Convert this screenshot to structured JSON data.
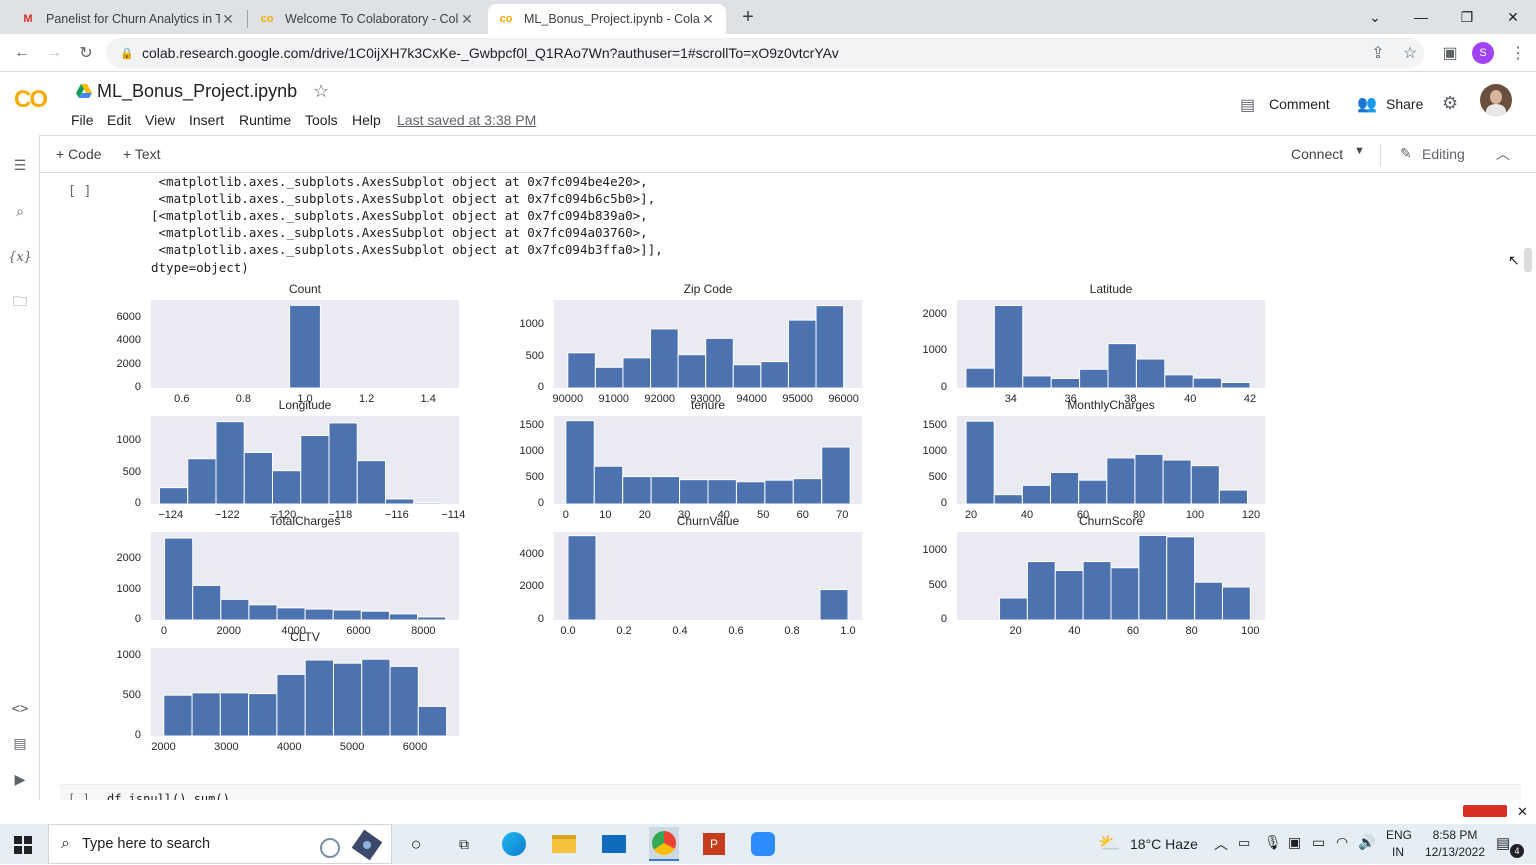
{
  "browser": {
    "tabs": [
      {
        "title": "Panelist for Churn Analytics in Te",
        "favicon": "M"
      },
      {
        "title": "Welcome To Colaboratory - Colab",
        "favicon": "co"
      },
      {
        "title": "ML_Bonus_Project.ipynb - Colab",
        "favicon": "co",
        "active": true
      }
    ],
    "new_tab": "+",
    "url": "colab.research.google.com/drive/1C0ijXH7k3CxKe-_Gwbpcf0l_Q1RAo7Wn?authuser=1#scrollTo=xO9z0vtcrYAv",
    "profile_initial": "S"
  },
  "colab": {
    "logo": "CO",
    "filename": "ML_Bonus_Project.ipynb",
    "menu": [
      "File",
      "Edit",
      "View",
      "Insert",
      "Runtime",
      "Tools",
      "Help"
    ],
    "last_saved": "Last saved at 3:38 PM",
    "comment": "Comment",
    "share": "Share",
    "toolbar": {
      "code": "+ Code",
      "text": "+ Text",
      "connect": "Connect",
      "editing": "Editing"
    },
    "cell_prompt": "[ ]",
    "next_cell_prompt": "[ ]",
    "next_cell_code": "df.isnull().sum()"
  },
  "output_text": [
    " <matplotlib.axes._subplots.AxesSubplot object at 0x7fc094be4e20>,",
    " <matplotlib.axes._subplots.AxesSubplot object at 0x7fc094b6c5b0>],",
    "[<matplotlib.axes._subplots.AxesSubplot object at 0x7fc094b839a0>,",
    " <matplotlib.axes._subplots.AxesSubplot object at 0x7fc094a03760>,",
    " <matplotlib.axes._subplots.AxesSubplot object at 0x7fc094b3ffa0>]],",
    "dtype=object)"
  ],
  "chart_data": [
    {
      "type": "bar",
      "title": "Count",
      "xlim": [
        0.5,
        1.5
      ],
      "ylim": [
        0,
        7500
      ],
      "xticks": [
        "0.6",
        "0.8",
        "1.0",
        "1.2",
        "1.4"
      ],
      "yticks": [
        "0",
        "2000",
        "4000",
        "6000"
      ],
      "bins": [
        [
          0.95,
          1.05
        ]
      ],
      "values": [
        7043
      ]
    },
    {
      "type": "bar",
      "title": "Zip Code",
      "xlim": [
        89700,
        96400
      ],
      "ylim": [
        0,
        1400
      ],
      "xticks": [
        "90000",
        "91000",
        "92000",
        "93000",
        "94000",
        "95000",
        "96000"
      ],
      "yticks": [
        "0",
        "500",
        "1000"
      ],
      "bin_start": 90000,
      "bin_width": 600,
      "values": [
        560,
        330,
        480,
        940,
        530,
        790,
        370,
        420,
        1080,
        1310
      ]
    },
    {
      "type": "bar",
      "title": "Latitude",
      "xlim": [
        32.2,
        42.5
      ],
      "ylim": [
        0,
        2400
      ],
      "xticks": [
        "34",
        "36",
        "38",
        "40",
        "42"
      ],
      "yticks": [
        "0",
        "1000",
        "2000"
      ],
      "bin_start": 32.5,
      "bin_width": 0.95,
      "values": [
        540,
        2250,
        330,
        260,
        510,
        1210,
        790,
        360,
        270,
        150
      ]
    },
    {
      "type": "bar",
      "title": "Longitude",
      "xlim": [
        -124.7,
        -113.8
      ],
      "ylim": [
        0,
        1400
      ],
      "xticks": [
        "−124",
        "−122",
        "−120",
        "−118",
        "−116",
        "−114"
      ],
      "yticks": [
        "0",
        "500",
        "1000"
      ],
      "bin_start": -124.4,
      "bin_width": 1.0,
      "values": [
        260,
        720,
        1310,
        820,
        530,
        1090,
        1290,
        690,
        80,
        20
      ]
    },
    {
      "type": "bar",
      "title": "tenure",
      "xlim": [
        -3,
        75
      ],
      "ylim": [
        0,
        1700
      ],
      "xticks": [
        "0",
        "10",
        "20",
        "30",
        "40",
        "50",
        "60",
        "70"
      ],
      "yticks": [
        "0",
        "500",
        "1000",
        "1500"
      ],
      "bin_start": 0,
      "bin_width": 7.2,
      "values": [
        1610,
        730,
        530,
        530,
        470,
        470,
        430,
        460,
        490,
        1100
      ]
    },
    {
      "type": "bar",
      "title": "MonthlyCharges",
      "xlim": [
        15,
        125
      ],
      "ylim": [
        0,
        1700
      ],
      "xticks": [
        "20",
        "40",
        "60",
        "80",
        "100",
        "120"
      ],
      "yticks": [
        "0",
        "500",
        "1000",
        "1500"
      ],
      "bin_start": 18.25,
      "bin_width": 10.05,
      "values": [
        1600,
        180,
        360,
        610,
        460,
        890,
        960,
        850,
        740,
        270
      ]
    },
    {
      "type": "bar",
      "title": "TotalCharges",
      "xlim": [
        -400,
        9100
      ],
      "ylim": [
        0,
        2900
      ],
      "xticks": [
        "0",
        "2000",
        "4000",
        "6000",
        "8000"
      ],
      "yticks": [
        "0",
        "1000",
        "2000"
      ],
      "bin_start": 19,
      "bin_width": 867,
      "values": [
        2700,
        1140,
        680,
        500,
        400,
        360,
        330,
        290,
        200,
        100
      ]
    },
    {
      "type": "bar",
      "title": "ChurnValue",
      "xlim": [
        -0.05,
        1.05
      ],
      "ylim": [
        0,
        5400
      ],
      "xticks": [
        "0.0",
        "0.2",
        "0.4",
        "0.6",
        "0.8",
        "1.0"
      ],
      "yticks": [
        "0",
        "2000",
        "4000"
      ],
      "bin_start": 0,
      "bin_width": 0.1,
      "values": [
        5174,
        0,
        0,
        0,
        0,
        0,
        0,
        0,
        0,
        1869
      ]
    },
    {
      "type": "bar",
      "title": "ChurnScore",
      "xlim": [
        0,
        105
      ],
      "ylim": [
        0,
        1280
      ],
      "xticks": [
        "20",
        "40",
        "60",
        "80",
        "100"
      ],
      "yticks": [
        "0",
        "500",
        "1000"
      ],
      "bin_start": 5,
      "bin_width": 9.5,
      "values": [
        0,
        320,
        850,
        720,
        850,
        760,
        1230,
        1210,
        550,
        480
      ]
    },
    {
      "type": "bar",
      "title": "CLTV",
      "xlim": [
        1800,
        6700
      ],
      "ylim": [
        0,
        1100
      ],
      "xticks": [
        "2000",
        "3000",
        "4000",
        "5000",
        "6000"
      ],
      "yticks": [
        "0",
        "500",
        "1000"
      ],
      "bin_start": 2003,
      "bin_width": 450,
      "values": [
        510,
        540,
        540,
        530,
        770,
        950,
        910,
        960,
        870,
        370
      ]
    }
  ],
  "taskbar": {
    "search_placeholder": "Type here to search",
    "weather": "18°C  Haze",
    "lang_top": "ENG",
    "lang_bottom": "IN",
    "time": "8:58 PM",
    "date": "12/13/2022",
    "notification_count": "4"
  },
  "colors": {
    "bar": "#4c72b0",
    "plot_bg": "#eaeaf2",
    "orange": "#f9ab00"
  }
}
